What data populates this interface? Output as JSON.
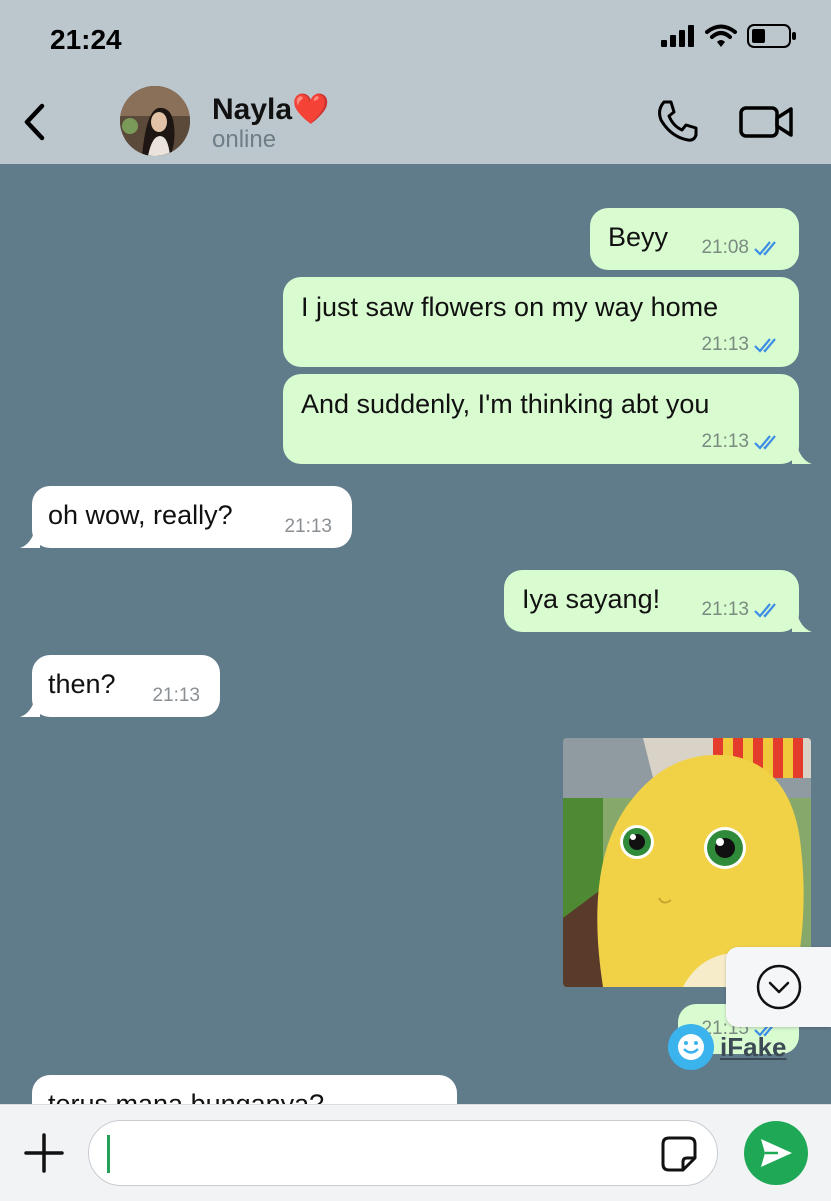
{
  "status": {
    "time": "21:24"
  },
  "contact": {
    "name": "Nayla",
    "heart": "❤️",
    "status": "online"
  },
  "messages": [
    {
      "dir": "out",
      "text": "Beyy",
      "time": "21:08"
    },
    {
      "dir": "out",
      "text": "I just saw flowers on my way home",
      "time": "21:13"
    },
    {
      "dir": "out",
      "text": "And suddenly, I'm thinking abt you",
      "time": "21:13"
    },
    {
      "dir": "in",
      "text": "oh wow, really?",
      "time": "21:13"
    },
    {
      "dir": "out",
      "text": "Iya sayang!",
      "time": "21:13"
    },
    {
      "dir": "in",
      "text": "then?",
      "time": "21:13"
    },
    {
      "dir": "out",
      "type": "image",
      "time": "21:15"
    },
    {
      "dir": "in",
      "text": "terus mana bunganya?"
    }
  ],
  "watermark": {
    "text": "iFake"
  },
  "colors": {
    "outgoing_bubble": "#d9fbd0",
    "incoming_bubble": "#ffffff",
    "chat_background": "#607b8a",
    "read_ticks": "#3c8de6",
    "send_button": "#1fa855"
  }
}
